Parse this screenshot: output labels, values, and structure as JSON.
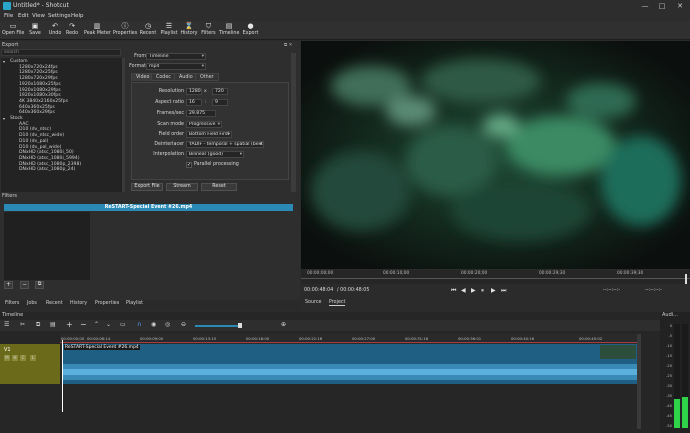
{
  "window": {
    "title": "Untitled* - Shotcut",
    "minimize": "—",
    "maximize": "□",
    "close": "✕"
  },
  "menu": [
    "File",
    "Edit",
    "View",
    "Settings",
    "Help"
  ],
  "toolbar": [
    {
      "label": "Open File",
      "icon": "folder-open-icon",
      "glyph": "▭"
    },
    {
      "label": "Save",
      "icon": "save-icon",
      "glyph": "▣"
    },
    {
      "label": "Undo",
      "icon": "undo-icon",
      "glyph": "↶"
    },
    {
      "label": "Redo",
      "icon": "redo-icon",
      "glyph": "↷"
    },
    {
      "label": "Peak Meter",
      "icon": "peak-meter-icon",
      "glyph": "▥"
    },
    {
      "label": "Properties",
      "icon": "properties-icon",
      "glyph": "ⓘ"
    },
    {
      "label": "Recent",
      "icon": "recent-icon",
      "glyph": "◷"
    },
    {
      "label": "Playlist",
      "icon": "playlist-icon",
      "glyph": "☰"
    },
    {
      "label": "History",
      "icon": "history-icon",
      "glyph": "⌛"
    },
    {
      "label": "Filters",
      "icon": "filters-icon",
      "glyph": "⛉"
    },
    {
      "label": "Timeline",
      "icon": "timeline-icon",
      "glyph": "▤"
    },
    {
      "label": "Export",
      "icon": "export-icon",
      "glyph": "●"
    }
  ],
  "export": {
    "title": "Export",
    "search_placeholder": "search",
    "presets": [
      {
        "label": "Custom",
        "group": true,
        "expanded": true
      },
      {
        "label": "1280x720x24fps"
      },
      {
        "label": "1280x720x25fps"
      },
      {
        "label": "1280x720x29fps"
      },
      {
        "label": "1920x1080x25fps"
      },
      {
        "label": "1920x1080x29fps"
      },
      {
        "label": "1920x1080x30fps"
      },
      {
        "label": "4K 3840x2160x25fps"
      },
      {
        "label": "640x360x25fps"
      },
      {
        "label": "640x360x29fps"
      },
      {
        "label": "Stock",
        "group": true,
        "expanded": true
      },
      {
        "label": "AAC"
      },
      {
        "label": "D10 (dv_ntsc)"
      },
      {
        "label": "D10 (dv_ntsc_wide)"
      },
      {
        "label": "D10 (dv_pal)"
      },
      {
        "label": "D10 (dv_pal_wide)"
      },
      {
        "label": "DNxHD (atsc_1080i_50)"
      },
      {
        "label": "DNxHD (atsc_1080i_5994)"
      },
      {
        "label": "DNxHD (atsc_1080p_2398)"
      },
      {
        "label": "DNxHD (atsc_1080p_24)"
      }
    ],
    "from_label": "From",
    "from_value": "Timeline",
    "format_label": "Format",
    "format_value": "mp4",
    "tabs": [
      "Video",
      "Codec",
      "Audio",
      "Other"
    ],
    "resolution_label": "Resolution",
    "res_w": "1280",
    "res_x": "x",
    "res_h": "720",
    "aspect_label": "Aspect ratio",
    "aspect_w": "16",
    "aspect_sep": ":",
    "aspect_h": "9",
    "fps_label": "Frames/sec",
    "fps_value": "29.875",
    "scan_label": "Scan mode",
    "scan_value": "Progressive",
    "field_label": "Field order",
    "field_value": "Bottom Field First",
    "deint_label": "Deinterlacer",
    "deint_value": "YADIF - temporal + spatial (best)",
    "interp_label": "Interpolation",
    "interp_value": "Bilinear (good)",
    "parallel_label": "Parallel processing",
    "parallel_checked": "✓",
    "buttons": {
      "export": "Export File",
      "stream": "Stream",
      "reset": "Reset"
    },
    "add_btn": "+",
    "remove_btn": "−"
  },
  "filters_panel": {
    "title": "Filters",
    "clip_name": "ReSTART-Special Event #26.mp4",
    "btn_add": "+",
    "btn_remove": "−",
    "btn_copy": "⧉"
  },
  "player": {
    "ruler": [
      "00:00:00;00",
      "00:00:10;00",
      "00:00:20;00",
      "00:00:29;30",
      "00:00:39;30"
    ],
    "timecode": "00:00:48:04",
    "duration": "/ 00:00:48:05",
    "controls": [
      "⏮",
      "◀",
      "▶",
      "⏸",
      "▶",
      "⏭"
    ],
    "right_tc_a": "--:--:--:-",
    "right_tc_b": "--:--:--:-",
    "tabs": [
      "Source",
      "Project"
    ]
  },
  "dock_tabs": [
    "Filters",
    "Jobs",
    "Recent",
    "History",
    "Properties",
    "Playlist"
  ],
  "timeline": {
    "title": "Timeline",
    "ruler": [
      "00:00:00;00",
      "00:00:06:14",
      "00:00:09:00",
      "00:00:13:15",
      "00:00:18:00",
      "00:00:22:16",
      "00:00:27:00",
      "00:00:31:16",
      "00:00:36:01",
      "00:00:40:16",
      "00:00:45:02"
    ],
    "track_name": "V1",
    "track_buttons": [
      "M",
      "H",
      "C",
      "L"
    ],
    "clip_name": "ReSTART-Special Event #26.mp4"
  },
  "audio_meter": {
    "title": "Audi...",
    "scale": [
      "0",
      "-5",
      "-10",
      "-15",
      "-20",
      "-25",
      "-30",
      "-35",
      "-40",
      "-45",
      "-50"
    ],
    "level_left": 0.28,
    "level_right": 0.3
  },
  "colors": {
    "accent": "#2a8ab5",
    "track": "#6a6a1a",
    "clip": "#1f5f83",
    "meter": "#2fd34a"
  }
}
